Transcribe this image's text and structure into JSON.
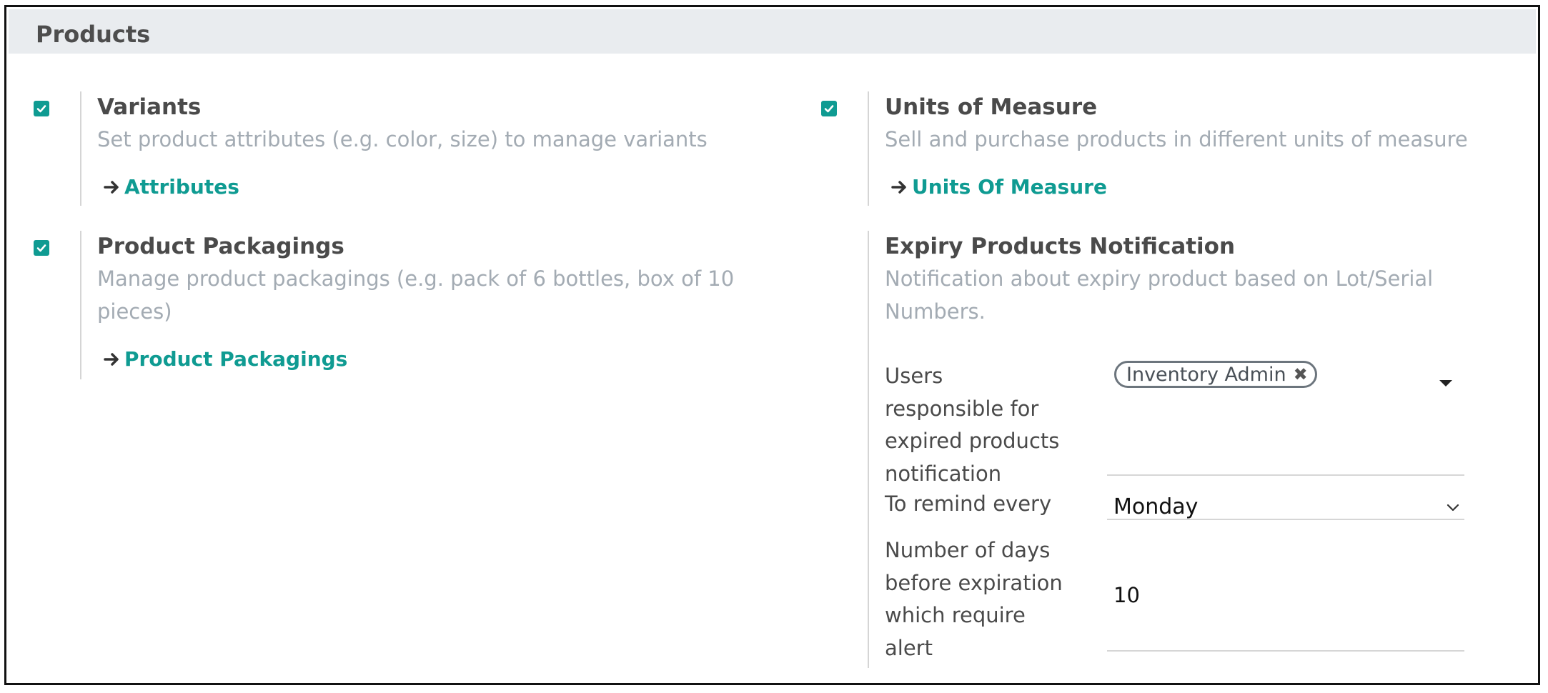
{
  "section": {
    "title": "Products"
  },
  "settings": {
    "variants": {
      "checked": true,
      "title": "Variants",
      "description": "Set product attributes (e.g. color, size) to manage variants",
      "link": "Attributes"
    },
    "units": {
      "checked": true,
      "title": "Units of Measure",
      "description": "Sell and purchase products in different units of measure",
      "link": "Units Of Measure"
    },
    "packagings": {
      "checked": true,
      "title": "Product Packagings",
      "description_line1": "Manage product packagings (e.g. pack of 6 bottles, box of 10",
      "description_line2": "pieces)",
      "link": "Product Packagings"
    },
    "expiry": {
      "title": "Expiry Products Notification",
      "description_line1": "Notification about expiry product based on Lot/Serial",
      "description_line2": "Numbers.",
      "users_label": [
        "Users",
        "responsible for",
        "expired products",
        "notification"
      ],
      "users_tag": "Inventory Admin",
      "remind_label": "To remind every",
      "remind_value": "Monday",
      "days_label": [
        "Number of days",
        "before expiration",
        "which require",
        "alert"
      ],
      "days_value": "10"
    }
  },
  "colors": {
    "accent": "#0f9b92",
    "header_bg": "#e9ecef",
    "muted_text": "#a3abb3"
  },
  "icons": {
    "checkbox": "check-icon",
    "link": "arrow-right-icon",
    "tag_remove": "close-icon",
    "dropdown": "caret-down-icon",
    "select": "chevron-down-icon"
  }
}
